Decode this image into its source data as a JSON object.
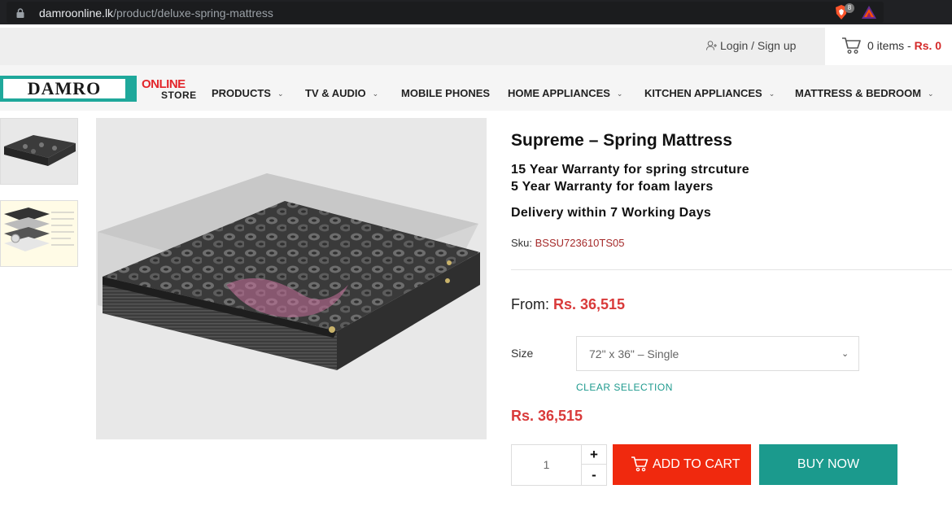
{
  "browser": {
    "url_domain": "damroonline.lk",
    "url_path": "/product/deluxe-spring-mattress",
    "shield_count": "8"
  },
  "topbar": {
    "login_label": "Login / Sign up",
    "cart_items": "0 items - ",
    "cart_amount": "Rs. 0"
  },
  "logo": {
    "brand": "DAMRO",
    "online": "ONLINE",
    "store": "STORE"
  },
  "nav": {
    "items": [
      {
        "label": "PRODUCTS",
        "has_dropdown": true
      },
      {
        "label": "TV & AUDIO",
        "has_dropdown": true
      },
      {
        "label": "MOBILE PHONES",
        "has_dropdown": false
      },
      {
        "label": "HOME APPLIANCES",
        "has_dropdown": true
      },
      {
        "label": "KITCHEN APPLIANCES",
        "has_dropdown": true
      },
      {
        "label": "MATTRESS & BEDROOM",
        "has_dropdown": true
      }
    ]
  },
  "product": {
    "title": "Supreme – Spring Mattress",
    "warranty_spring": "15 Year Warranty for spring strcuture",
    "warranty_foam": "5 Year Warranty for foam layers",
    "delivery": "Delivery within 7 Working Days",
    "sku_label": "Sku: ",
    "sku_value": "BSSU723610TS05",
    "from_label": "From: ",
    "from_price": "Rs. 36,515",
    "size_label": "Size",
    "size_selected": "72\" x 36\" – Single",
    "clear_selection": "CLEAR SELECTION",
    "price": "Rs. 36,515",
    "quantity": "1",
    "plus": "+",
    "minus": "-",
    "add_to_cart": "ADD TO CART",
    "buy_now": "BUY NOW"
  },
  "colors": {
    "accent_teal": "#1b9a8d",
    "cart_red": "#f0290e",
    "price_red": "#d93a3a"
  },
  "icons": [
    "lock-icon",
    "brave-shield-icon",
    "bat-icon",
    "user-icon",
    "cart-icon",
    "chevron-down-icon"
  ]
}
